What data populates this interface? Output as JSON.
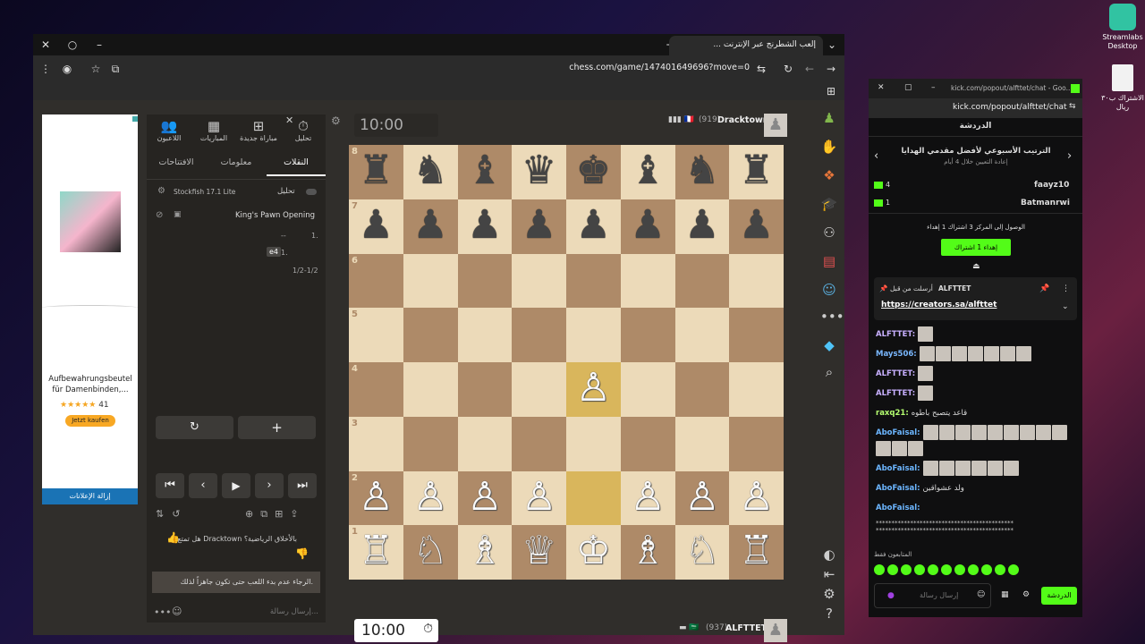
{
  "desktop": {
    "icons": [
      {
        "label": "Streamlabs Desktop"
      },
      {
        "label": "الاشتراك ب٣٠ ريال"
      }
    ]
  },
  "browser": {
    "tab_title": "إلعب الشطرنج عبر الإنترنت ...",
    "url": "chess.com/game/147401649696?move=0"
  },
  "ad": {
    "product": "Aufbewahrungsbeutel für Damenbinden,...",
    "rating": "41",
    "button": "Jetzt kaufen",
    "remove_ads": "إزالة الإعلانات"
  },
  "panel": {
    "nav": [
      "تحليل",
      "مباراة جديدة",
      "المباريات",
      "اللاعبون"
    ],
    "tabs": [
      "النقلات",
      "معلومات",
      "الافتتاحات"
    ],
    "engine": "Stockfish 17.1 Lite",
    "analysis": "تحليل",
    "opening": "King's Pawn Opening",
    "moves": [
      {
        "num": "1.",
        "white": "e4",
        "black": "--"
      }
    ],
    "result": "1/2-1/2",
    "feedback": "هل تمتع Dracktown بالأخلاق الرياضية؟",
    "notice": "الرجاء عدم بدء اللعب حتى تكون جاهزاً لذلك.",
    "chat_placeholder": "إرسال رسالة..."
  },
  "game": {
    "top": {
      "name": "Dracktown",
      "rating": "(919)",
      "clock": "10:00"
    },
    "bottom": {
      "name": "ALFTTET",
      "rating": "(937)",
      "clock": "10:00"
    },
    "board": [
      [
        "♜",
        "♞",
        "♝",
        "♛",
        "♚",
        "♝",
        "♞",
        "♜"
      ],
      [
        "♟",
        "♟",
        "♟",
        "♟",
        "♟",
        "♟",
        "♟",
        "♟"
      ],
      [
        "",
        "",
        "",
        "",
        "",
        "",
        "",
        ""
      ],
      [
        "",
        "",
        "",
        "",
        "",
        "",
        "",
        ""
      ],
      [
        "",
        "",
        "",
        "",
        "♙",
        "",
        "",
        ""
      ],
      [
        "",
        "",
        "",
        "",
        "",
        "",
        "",
        ""
      ],
      [
        "♙",
        "♙",
        "♙",
        "♙",
        "",
        "♙",
        "♙",
        "♙"
      ],
      [
        "♖",
        "♘",
        "♗",
        "♕",
        "♔",
        "♗",
        "♘",
        "♖"
      ]
    ],
    "ranks": [
      "8",
      "7",
      "6",
      "5",
      "4",
      "3",
      "2",
      "1"
    ],
    "files": [
      "a",
      "b",
      "c",
      "d",
      "e",
      "f",
      "g",
      "h"
    ],
    "colors": {
      "light": "#ecdab9",
      "dark": "#ae8a68",
      "highlight": "#d9b65c"
    }
  },
  "kick": {
    "url": "kick.com/popout/alfttet/chat",
    "title_bar": "kick.com/popout/alfttet/chat - Goo...",
    "header": "الدردشة",
    "leaderboard_title": "الترتيب الأسبوعي لأفضل مقدمي الهدايا",
    "leaderboard_sub": "إعادة التعيين خلال 4 أيام",
    "leaders": [
      {
        "name": "faayz10",
        "count": "4"
      },
      {
        "name": "Batmanrwi",
        "count": "1"
      }
    ],
    "goal": "الوصول إلى المركز 3 اشتراك 1 إهداء",
    "gift_button": "إهداء 1 اشتراك",
    "pinned_by": "ALFTTET",
    "pinned_label": "أرسلت من قبل",
    "pinned_link": "https://creators.sa/alfttet",
    "messages": [
      {
        "user": "ALFTTET",
        "text": "",
        "emotes": 1
      },
      {
        "user": "Mays506",
        "text": "",
        "emotes": 7
      },
      {
        "user": "ALFTTET",
        "text": "",
        "emotes": 1
      },
      {
        "user": "ALFTTET",
        "text": "",
        "emotes": 1
      },
      {
        "user": "raxq21",
        "text": "قاعد يتصبح باطوه",
        "emotes": 0
      },
      {
        "user": "AboFaisal",
        "text": "",
        "emotes": 12
      },
      {
        "user": "AboFaisal",
        "text": "",
        "emotes": 6
      },
      {
        "user": "AboFaisal",
        "text": "ولد عشواقين",
        "emotes": 0
      },
      {
        "user": "AboFaisal",
        "text": "",
        "emotes": 0
      }
    ],
    "stars": "********************************************",
    "viewers": "المتابعون فقط",
    "input_placeholder": "إرسال رسالة",
    "send": "الدردشة"
  }
}
